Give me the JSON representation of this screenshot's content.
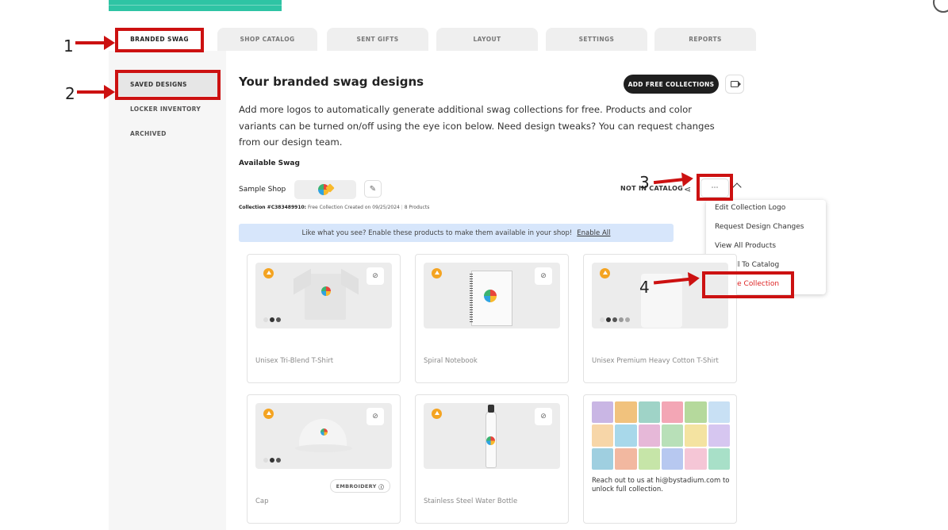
{
  "tabs": [
    "BRANDED SWAG",
    "SHOP CATALOG",
    "SENT GIFTS",
    "LAYOUT",
    "SETTINGS",
    "REPORTS"
  ],
  "sidebar": [
    "SAVED DESIGNS",
    "LOCKER INVENTORY",
    "ARCHIVED"
  ],
  "main": {
    "title": "Your branded swag designs",
    "add_button": "ADD FREE COLLECTIONS",
    "description": "Add more logos to automatically generate additional swag collections for free. Products and color variants can be turned on/off using the eye icon below. Need design tweaks? You can request changes from our design team.",
    "available_label": "Available Swag"
  },
  "collection": {
    "shop_name": "Sample Shop",
    "id_label": "Collection #C383489910:",
    "info": "Free Collection Created on 09/25/2024",
    "count": "8 Products",
    "status": "NOT IN CATALOG",
    "more_icon": "⋯"
  },
  "menu": [
    "Edit Collection Logo",
    "Request Design Changes",
    "View All Products",
    "Add All To Catalog",
    "Archive Collection"
  ],
  "banner": {
    "text": "Like what you see? Enable these products to make them available in your shop!",
    "link": "Enable All"
  },
  "products": [
    {
      "title": "Unisex Tri-Blend T-Shirt"
    },
    {
      "title": "Spiral Notebook"
    },
    {
      "title": "Unisex Premium Heavy Cotton T-Shirt"
    },
    {
      "title": "Cap",
      "tag": "EMBROIDERY"
    },
    {
      "title": "Stainless Steel Water Bottle"
    }
  ],
  "reach_text": "Reach out to us at hi@bystadium.com to unlock full collection.",
  "annotations": [
    "1",
    "2",
    "3",
    "4"
  ],
  "colors": {
    "accent_red": "#cc1111",
    "badge_orange": "#f4a422",
    "banner_blue": "#d7e6fb",
    "teal": "#2ec4a4"
  }
}
